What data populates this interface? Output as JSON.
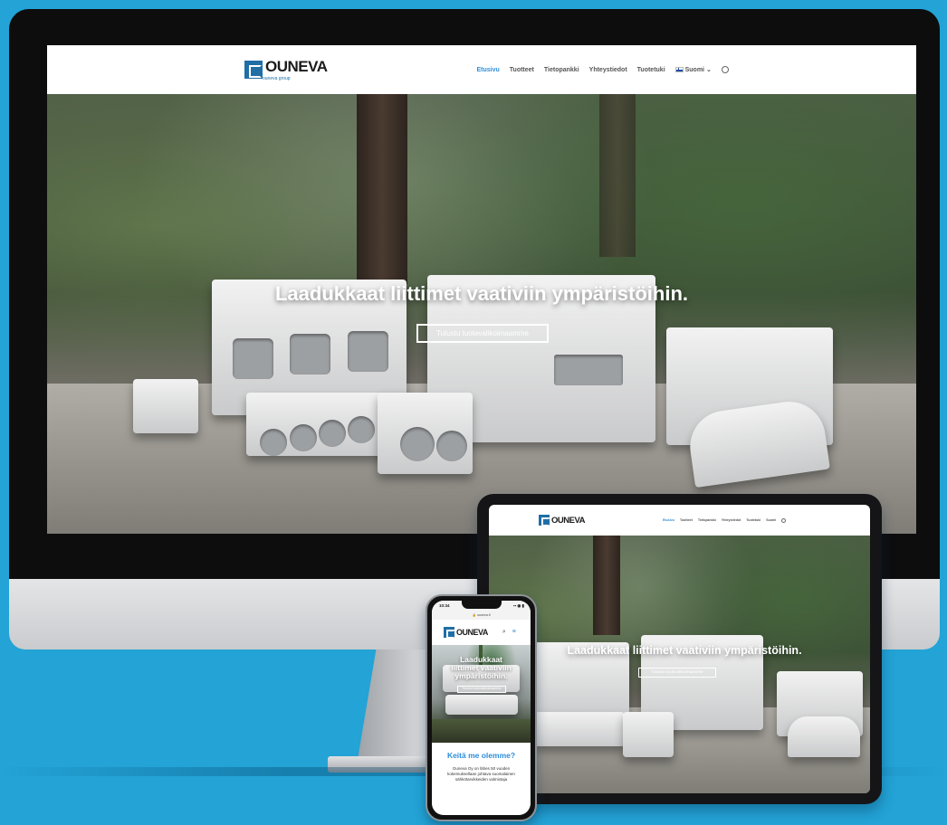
{
  "site": {
    "logo_text": "OUNEVA",
    "logo_sub": "ouneva group",
    "nav": {
      "home": "Etusivu",
      "products": "Tuotteet",
      "datasheets": "Tietopankki",
      "contact": "Yhteystiedot",
      "support": "Tuotetuki",
      "language": "Suomi"
    },
    "hero_title": "Laadukkaat liittimet vaativiin ympäristöihin.",
    "hero_button": "Tutustu tuotevalikoimaamme"
  },
  "tablet": {
    "hero_title": "Laadukkaat liittimet vaativiin ympäristöihin."
  },
  "phone": {
    "status_time": "10:34",
    "status_icons": "▪▪ ◉ ▮",
    "url": "🔒 ouneva.fi",
    "hero_title_lines": [
      "Laadukkaat",
      "liittimet vaativiin",
      "ympäristöihin."
    ],
    "about_title": "Keitä me olemme?",
    "about_text": "Ouneva Oy on lähes 50 vuoden kokemuksellaan johtava suomalainen sähkötarvikkeiden valmistaja"
  },
  "colors": {
    "background": "#23a3d6",
    "accent": "#2e8dd8",
    "logo": "#1f6fa6"
  },
  "icons": [
    "search-icon",
    "finnish-flag-icon",
    "chevron-down-icon",
    "menu-icon"
  ]
}
